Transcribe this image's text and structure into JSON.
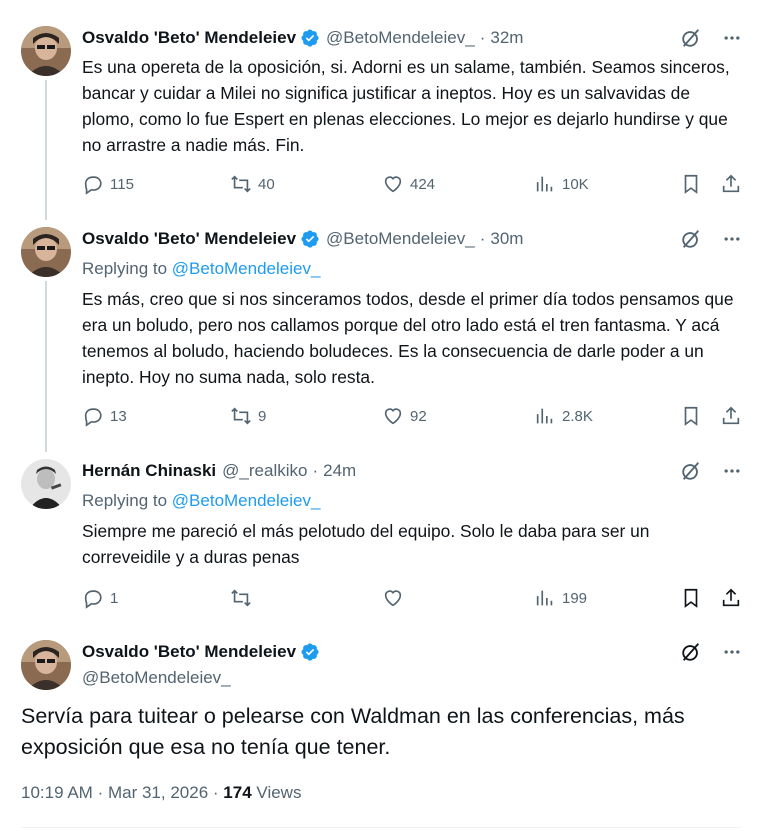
{
  "colors": {
    "text": "#0f1419",
    "secondary": "#536471",
    "link": "#1d9bf0",
    "verified": "#1d9bf0",
    "thread_line": "#cfd9de"
  },
  "icons": [
    "verified-badge-icon",
    "grok-icon",
    "more-icon",
    "reply-icon",
    "retweet-icon",
    "like-icon",
    "views-icon",
    "bookmark-icon",
    "share-icon"
  ],
  "tweets": [
    {
      "name": "Osvaldo 'Beto' Mendeleiev",
      "handle": "@BetoMendeleiev_",
      "dot": "·",
      "time": "32m",
      "text": "Es una opereta de la oposición, si. Adorni es un salame, también. Seamos sinceros, bancar y cuidar a Milei no significa justificar a ineptos. Hoy es un salvavidas de plomo, como lo fue Espert en plenas elecciones. Lo mejor es dejarlo hundirse y que no arrastre a nadie más. Fin.",
      "replies": "115",
      "retweets": "40",
      "likes": "424",
      "views": "10K"
    },
    {
      "name": "Osvaldo 'Beto' Mendeleiev",
      "handle": "@BetoMendeleiev_",
      "dot": "·",
      "time": "30m",
      "replying_label": "Replying to",
      "replying_to": "@BetoMendeleiev_",
      "text": "Es más, creo que si nos sinceramos todos, desde el primer día todos pensamos que era un boludo, pero nos callamos porque del otro lado está el tren fantasma. Y acá tenemos al boludo, haciendo boludeces. Es la consecuencia de darle poder a un inepto. Hoy no suma nada, solo resta.",
      "replies": "13",
      "retweets": "9",
      "likes": "92",
      "views": "2.8K"
    },
    {
      "name": "Hernán Chinaski",
      "handle": "@_realkiko",
      "dot": "·",
      "time": "24m",
      "replying_label": "Replying to",
      "replying_to": "@BetoMendeleiev_",
      "text": "Siempre me pareció el más pelotudo del equipo. Solo le daba para ser un correveidile y a duras penas",
      "replies": "1",
      "retweets": "",
      "likes": "",
      "views": "199"
    }
  ],
  "main_tweet": {
    "name": "Osvaldo 'Beto' Mendeleiev",
    "handle": "@BetoMendeleiev_",
    "text": "Servía para tuitear o pelearse con Waldman en las conferencias, más exposición que esa no tenía que tener.",
    "time": "10:19 AM",
    "date": "Mar 31, 2026",
    "views_count": "174",
    "views_label": "Views",
    "sep": "·"
  }
}
